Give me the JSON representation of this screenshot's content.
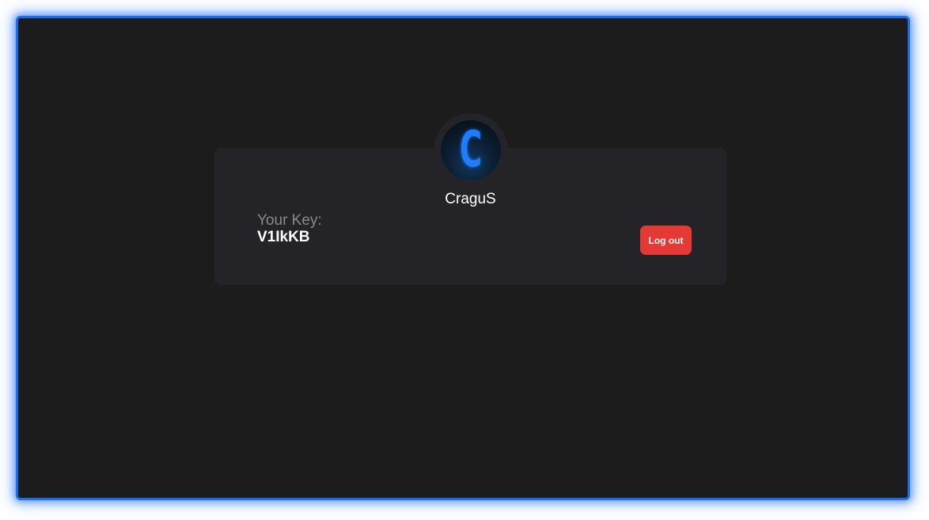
{
  "profile": {
    "avatar_letter": "C",
    "username": "CraguS",
    "key_label": "Your Key:",
    "key_value": "V1IkKB"
  },
  "actions": {
    "logout_label": "Log out"
  },
  "colors": {
    "frame_border": "#1a6cf0",
    "background": "#1c1c1c",
    "card": "#242428",
    "logout_button": "#e53935",
    "avatar_letter": "#1f7bff"
  },
  "icons": {
    "avatar": "avatar-icon"
  }
}
